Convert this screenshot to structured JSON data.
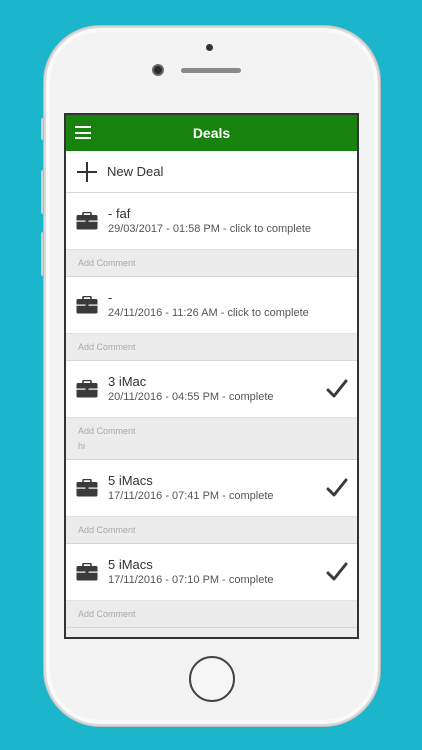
{
  "appbar": {
    "title": "Deals"
  },
  "new_deal": {
    "label": "New Deal"
  },
  "deals": [
    {
      "title": "- faf",
      "subtitle": "29/03/2017 - 01:58 PM - click to complete",
      "completed": false,
      "comment_placeholder": "Add Comment",
      "comment": ""
    },
    {
      "title": "-",
      "subtitle": "24/11/2016 - 11:26 AM - click to complete",
      "completed": false,
      "comment_placeholder": "Add Comment",
      "comment": ""
    },
    {
      "title": "3 iMac",
      "subtitle": "20/11/2016 - 04:55 PM - complete",
      "completed": true,
      "comment_placeholder": "Add Comment",
      "comment": "hi"
    },
    {
      "title": "5 iMacs",
      "subtitle": "17/11/2016 - 07:41 PM - complete",
      "completed": true,
      "comment_placeholder": "Add Comment",
      "comment": ""
    },
    {
      "title": "5 iMacs",
      "subtitle": "17/11/2016 - 07:10 PM - complete",
      "completed": true,
      "comment_placeholder": "Add Comment",
      "comment": ""
    }
  ],
  "colors": {
    "background": "#1bb6cc",
    "appbar": "#18820f"
  },
  "icons": {
    "menu": "hamburger-icon",
    "add": "plus-icon",
    "deal": "briefcase-icon",
    "done": "checkmark-icon"
  }
}
